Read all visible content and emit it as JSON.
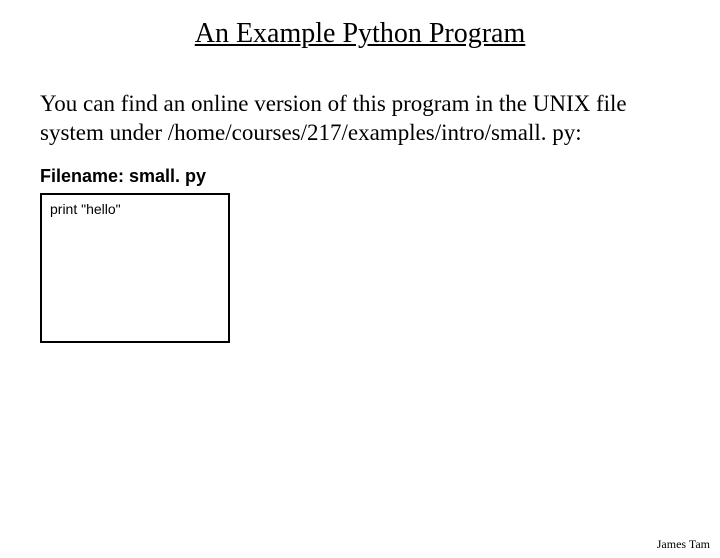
{
  "title": "An Example Python Program",
  "description": "You can find an online version of this program in the UNIX file system under /home/courses/217/examples/intro/small. py:",
  "filename_label": "Filename: small. py",
  "code": "print \"hello\"",
  "author": "James Tam"
}
